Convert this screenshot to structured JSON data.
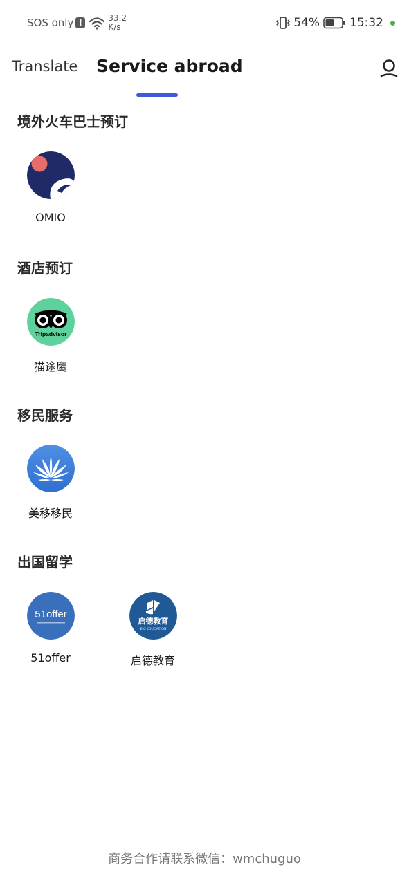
{
  "status_bar": {
    "carrier": "SOS only",
    "alert_glyph": "!",
    "net_speed_value": "33.2",
    "net_speed_unit": "K/s",
    "battery_percent": "54%",
    "time": "15:32",
    "indicator_color": "#46b34a"
  },
  "header": {
    "tabs": [
      {
        "label": "Translate",
        "active": false
      },
      {
        "label": "Service abroad",
        "active": true
      }
    ],
    "accent_color": "#3b5bdb",
    "profile_icon": "person-icon"
  },
  "sections": [
    {
      "title": "境外火车巴士预订",
      "apps": [
        {
          "label": "OMIO",
          "icon": "omio-logo-icon"
        }
      ]
    },
    {
      "title": "酒店预订",
      "apps": [
        {
          "label": "猫途鹰",
          "icon": "tripadvisor-logo-icon",
          "logo_text": "Tripadvisor"
        }
      ]
    },
    {
      "title": "移民服务",
      "apps": [
        {
          "label": "美移移民",
          "icon": "lotus-logo-icon"
        }
      ]
    },
    {
      "title": "出国留学",
      "apps": [
        {
          "label": "51offer",
          "icon": "51offer-logo-icon",
          "logo_text": "51offer"
        },
        {
          "label": "启德教育",
          "icon": "eic-education-logo-icon",
          "logo_text": "启德教育",
          "logo_subtext": "EIC EDUCATION"
        }
      ]
    }
  ],
  "footer": {
    "text": "商务合作请联系微信：wmchuguo"
  }
}
